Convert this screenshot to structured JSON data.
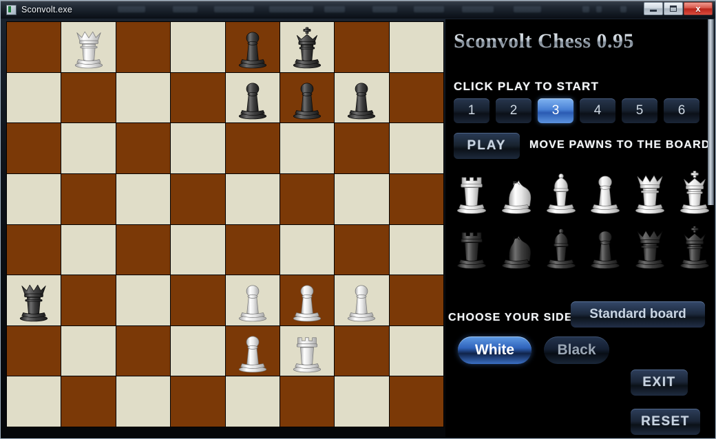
{
  "window": {
    "title": "Sconvolt.exe",
    "controls": {
      "minimize": "minimize-button",
      "maximize": "maximize-button",
      "close": "close-button",
      "close_label": "x"
    }
  },
  "panel": {
    "app_title": "Sconvolt Chess 0.95",
    "hint_start": "CLICK PLAY TO START",
    "hint_move": "MOVE PAWNS TO THE BOARD",
    "play_label": "PLAY",
    "choose_side_label": "CHOOSE YOUR SIDE",
    "standard_board_label": "Standard board",
    "side_white_label": "White",
    "side_black_label": "Black",
    "exit_label": "EXIT",
    "reset_label": "RESET",
    "selected_level": "3",
    "selected_side": "White",
    "levels": [
      {
        "label": "1",
        "selected": false
      },
      {
        "label": "2",
        "selected": false
      },
      {
        "label": "3",
        "selected": true
      },
      {
        "label": "4",
        "selected": false
      },
      {
        "label": "5",
        "selected": false
      },
      {
        "label": "6",
        "selected": false
      }
    ],
    "white_tray": [
      "rook",
      "knight",
      "bishop",
      "pawn",
      "queen",
      "king"
    ],
    "black_tray": [
      "rook",
      "knight",
      "bishop",
      "pawn",
      "queen",
      "king"
    ]
  },
  "board": {
    "light_color": "#e0ddc8",
    "dark_color": "#7b3907",
    "rows": 8,
    "cols": 8,
    "pieces": [
      {
        "row": 0,
        "col": 1,
        "color": "white",
        "type": "queen"
      },
      {
        "row": 0,
        "col": 4,
        "color": "black",
        "type": "pawn"
      },
      {
        "row": 0,
        "col": 5,
        "color": "black",
        "type": "king"
      },
      {
        "row": 1,
        "col": 4,
        "color": "black",
        "type": "pawn"
      },
      {
        "row": 1,
        "col": 5,
        "color": "black",
        "type": "pawn"
      },
      {
        "row": 1,
        "col": 6,
        "color": "black",
        "type": "pawn"
      },
      {
        "row": 5,
        "col": 0,
        "color": "black",
        "type": "queen"
      },
      {
        "row": 5,
        "col": 4,
        "color": "white",
        "type": "pawn"
      },
      {
        "row": 5,
        "col": 5,
        "color": "white",
        "type": "pawn"
      },
      {
        "row": 5,
        "col": 6,
        "color": "white",
        "type": "pawn"
      },
      {
        "row": 6,
        "col": 4,
        "color": "white",
        "type": "pawn"
      },
      {
        "row": 6,
        "col": 5,
        "color": "white",
        "type": "rook"
      }
    ]
  }
}
